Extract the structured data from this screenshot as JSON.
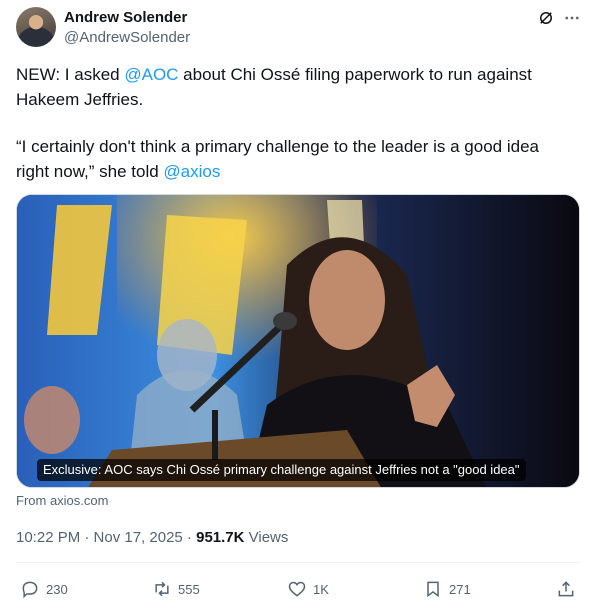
{
  "author": {
    "name": "Andrew Solender",
    "handle": "@AndrewSolender"
  },
  "tweet": {
    "p1_pre": "NEW: I asked ",
    "p1_mention": "@AOC",
    "p1_post": " about Chi Ossé filing paperwork to run against Hakeem Jeffries.",
    "p2_pre": "“I certainly don't think a primary challenge to the leader is a good idea right now,” she told ",
    "p2_mention": "@axios"
  },
  "media": {
    "caption": "Exclusive: AOC says Chi Ossé primary challenge against Jeffries not a \"good idea\"",
    "source": "From axios.com"
  },
  "meta": {
    "time": "10:22 PM · Nov 17, 2025 · ",
    "views_count": "951.7K",
    "views_label": " Views"
  },
  "actions": {
    "replies": "230",
    "reposts": "555",
    "likes": "1K",
    "bookmarks": "271"
  },
  "colors": {
    "accent": "#1d9bf0",
    "secondary_text": "#536471",
    "primary_text": "#0f1419"
  }
}
